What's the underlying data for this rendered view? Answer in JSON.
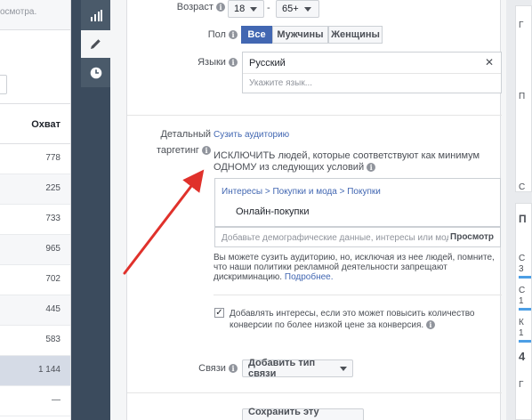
{
  "left_table": {
    "breadcrumb_fragment": "осмотра.",
    "column_header": "Охват",
    "rows": [
      "778",
      "225",
      "733",
      "965",
      "702",
      "445",
      "583",
      "1 144",
      "—"
    ]
  },
  "toolbar": {
    "items": [
      {
        "icon": "bar-chart-icon"
      },
      {
        "icon": "pencil-icon"
      },
      {
        "icon": "clock-icon"
      }
    ]
  },
  "form": {
    "age": {
      "label": "Возраст",
      "from": "18",
      "separator": "-",
      "to": "65+"
    },
    "gender": {
      "label": "Пол",
      "options": [
        "Все",
        "Мужчины",
        "Женщины"
      ],
      "selected": "Все"
    },
    "languages": {
      "label": "Языки",
      "chip": "Русский",
      "clear": "✕",
      "placeholder": "Укажите язык..."
    },
    "detailed": {
      "label_line1": "Детальный",
      "label_line2": "таргетинг",
      "narrow_link": "Сузить аудиторию",
      "exclude_heading": "ИСКЛЮЧИТЬ людей, которые соответствуют как минимум ОДНОМУ из следующих условий",
      "breadcrumb": "Интересы > Покупки и мода > Покупки",
      "interest": "Онлайн-покупки",
      "search_placeholder": "Добавьте демографические данные, интересы или модел...",
      "browse_label": "Просмотр",
      "notice": "Вы можете сузить аудиторию, но, исключая из нее людей, помните, что наши политики рекламной деятельности запрещают дискриминацию.",
      "learn_more": "Подробнее.",
      "expand_checkbox_label": "Добавлять интересы, если это может повысить количество конверсии по более низкой цене за конверсия.",
      "expand_checked": true
    },
    "connections": {
      "label": "Связи",
      "button": "Добавить тип связи"
    },
    "save_audience": "Сохранить эту аудиторию"
  },
  "right_panel": {
    "lines": [
      "Г",
      "П",
      "С",
      "3",
      "1",
      "К",
      "1",
      "4",
      "Г"
    ]
  },
  "colors": {
    "accent": "#4267b2",
    "toolbar": "#4a5a6a",
    "arrow": "#e0312b"
  }
}
